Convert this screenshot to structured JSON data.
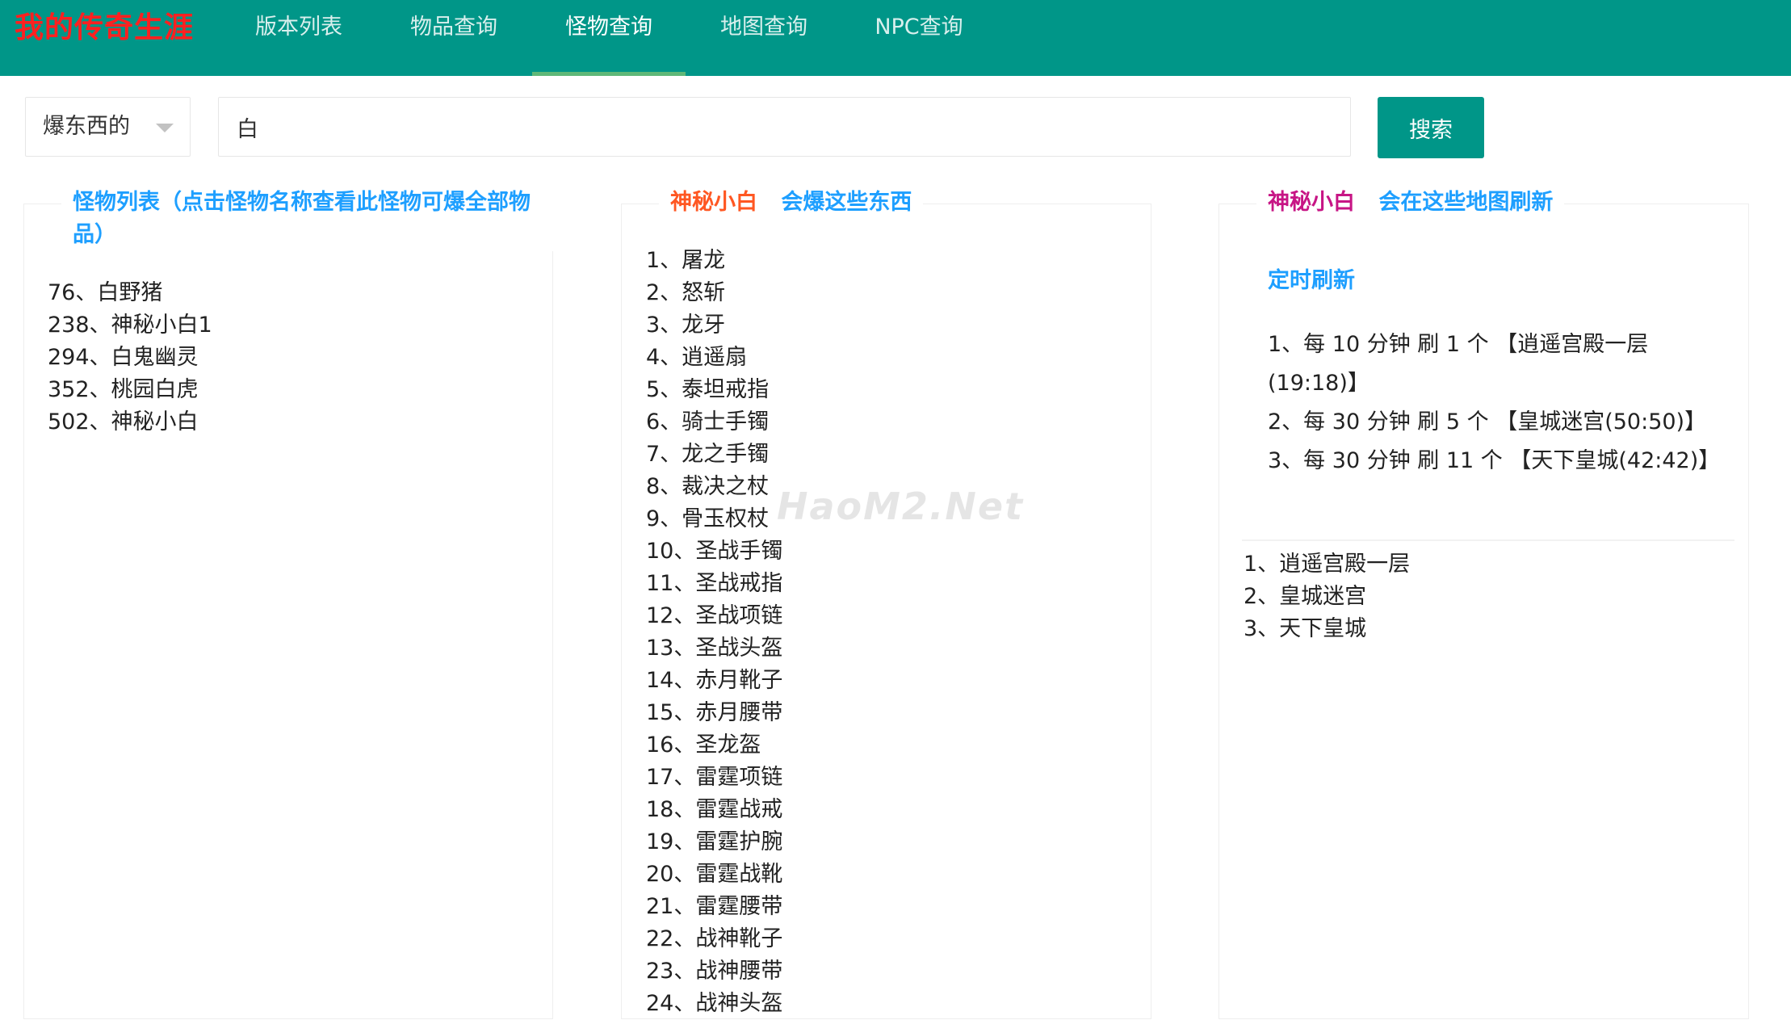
{
  "header": {
    "brand": "我的传奇生涯",
    "brand_color": "#FF2020",
    "nav": [
      {
        "label": "版本列表",
        "active": false
      },
      {
        "label": "物品查询",
        "active": false
      },
      {
        "label": "怪物查询",
        "active": true
      },
      {
        "label": "地图查询",
        "active": false
      },
      {
        "label": "NPC查询",
        "active": false
      }
    ]
  },
  "search": {
    "type_select": "爆东西的",
    "query": "白",
    "button_label": "搜索"
  },
  "monster_panel": {
    "title": "怪物列表（点击怪物名称查看此怪物可爆全部物品）",
    "items": [
      "76、白野猪",
      "238、神秘小白1",
      "294、白鬼幽灵",
      "352、桃园白虎",
      "502、神秘小白"
    ]
  },
  "drops_panel": {
    "monster_name": "神秘小白",
    "title_suffix": "会爆这些东西",
    "items": [
      "1、屠龙",
      "2、怒斩",
      "3、龙牙",
      "4、逍遥扇",
      "5、泰坦戒指",
      "6、骑士手镯",
      "7、龙之手镯",
      "8、裁决之杖",
      "9、骨玉权杖",
      "10、圣战手镯",
      "11、圣战戒指",
      "12、圣战项链",
      "13、圣战头盔",
      "14、赤月靴子",
      "15、赤月腰带",
      "16、圣龙盔",
      "17、雷霆项链",
      "18、雷霆战戒",
      "19、雷霆护腕",
      "20、雷霆战靴",
      "21、雷霆腰带",
      "22、战神靴子",
      "23、战神腰带",
      "24、战神头盔"
    ]
  },
  "maps_panel": {
    "monster_name": "神秘小白",
    "title_suffix": "会在这些地图刷新",
    "timer_title": "定时刷新",
    "timers": [
      "1、每 10 分钟 刷 1 个 【逍遥宫殿一层(19:18)】",
      "2、每 30 分钟 刷 5 个 【皇城迷宫(50:50)】",
      "3、每 30 分钟 刷 11 个 【天下皇城(42:42)】"
    ],
    "maps": [
      "1、逍遥宫殿一层",
      "2、皇城迷宫",
      "3、天下皇城"
    ]
  },
  "watermark": "HaoM2.Net"
}
